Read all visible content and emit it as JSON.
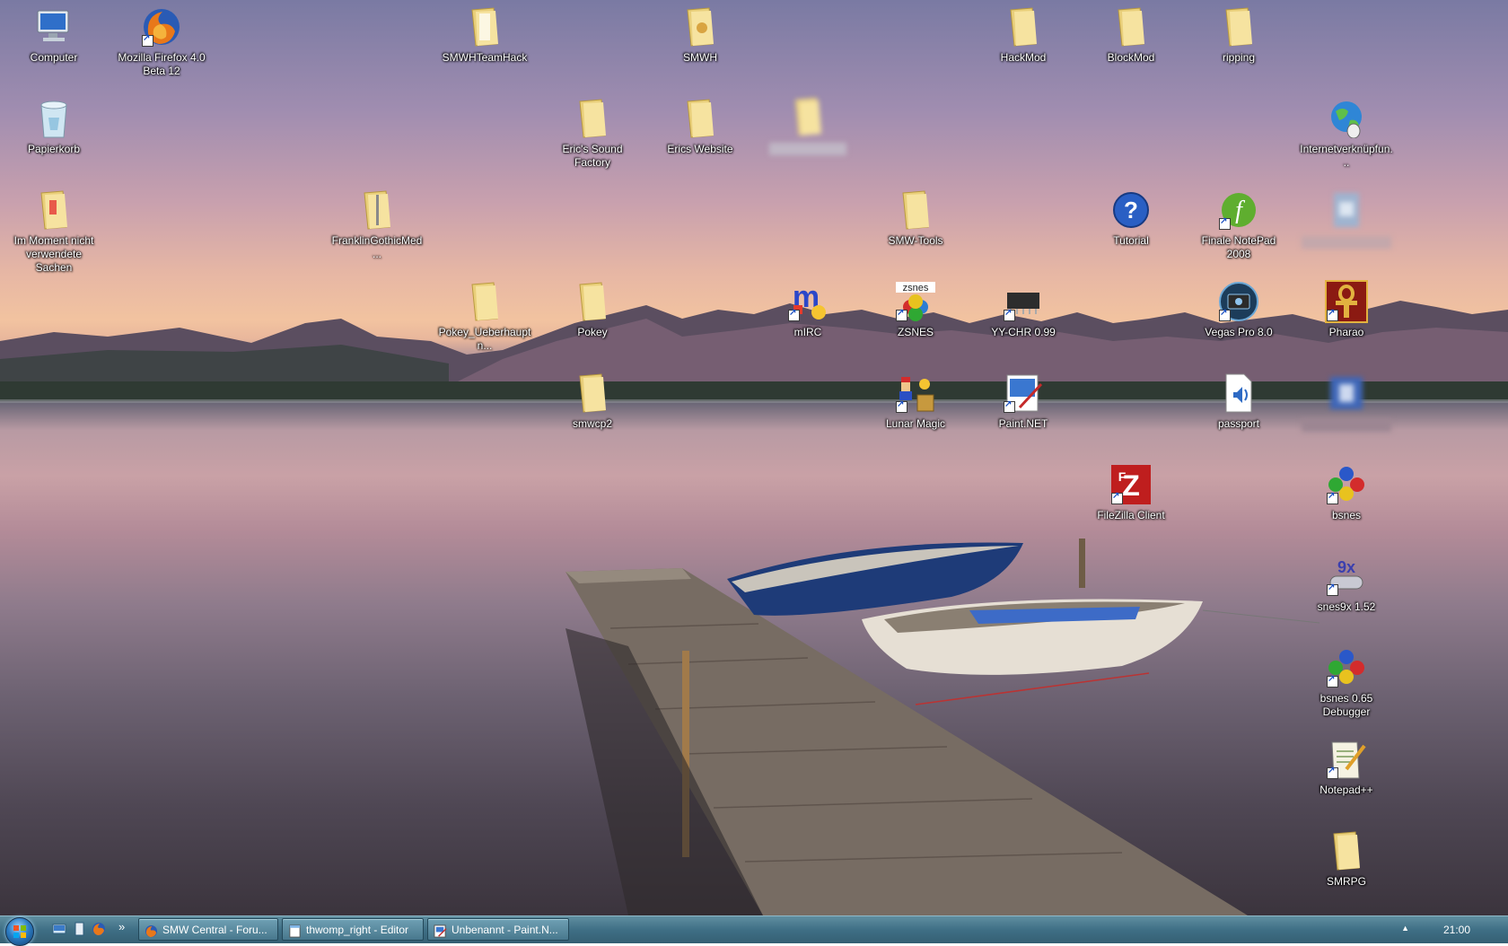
{
  "desktop": {
    "icons": [
      {
        "label": "Computer"
      },
      {
        "label": "Mozilla Firefox 4.0 Beta 12"
      },
      {
        "label": "SMWHTeamHack"
      },
      {
        "label": "SMWH"
      },
      {
        "label": "HackMod"
      },
      {
        "label": "BlockMod"
      },
      {
        "label": "ripping"
      },
      {
        "label": "Papierkorb"
      },
      {
        "label": "Eric's Sound Factory"
      },
      {
        "label": "Erics Website"
      },
      {
        "label": "Internetverknüpfun..."
      },
      {
        "label": "Im Moment nicht verwendete Sachen"
      },
      {
        "label": "FranklinGothicMed..."
      },
      {
        "label": "SMW-Tools"
      },
      {
        "label": "Tutorial"
      },
      {
        "label": "Finale NotePad 2008"
      },
      {
        "label": "Pokey_Ueberhauptn..."
      },
      {
        "label": "Pokey"
      },
      {
        "label": "mIRC"
      },
      {
        "label": "ZSNES"
      },
      {
        "label": "YY-CHR 0.99"
      },
      {
        "label": "Vegas Pro 8.0"
      },
      {
        "label": "Pharao"
      },
      {
        "label": "smwcp2"
      },
      {
        "label": "Lunar Magic"
      },
      {
        "label": "Paint.NET"
      },
      {
        "label": "passport"
      },
      {
        "label": "FileZilla Client"
      },
      {
        "label": "bsnes"
      },
      {
        "label": "snes9x 1.52"
      },
      {
        "label": "bsnes 0.65 Debugger"
      },
      {
        "label": "Notepad++"
      },
      {
        "label": "SMRPG"
      }
    ]
  },
  "taskbar": {
    "tasks": [
      {
        "label": "SMW Central - Foru..."
      },
      {
        "label": "thwomp_right - Editor"
      },
      {
        "label": "Unbenannt - Paint.N..."
      }
    ],
    "quicklaunch_more": "»",
    "tray_chevron": "▲",
    "clock": "21:00"
  }
}
